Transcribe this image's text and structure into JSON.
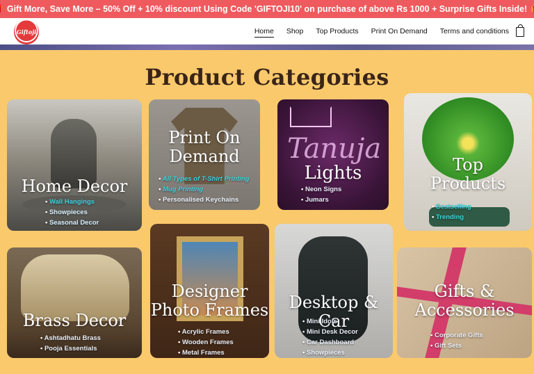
{
  "promo": {
    "text": "Gift More, Save More – 50% Off + 10% discount Using Code 'GIFTOJI10' on purchase of above Rs 1000 + Surprise Gifts Inside!",
    "gift_glyph": "🎁"
  },
  "header": {
    "logo_text": "Giftoji",
    "nav": [
      "Home",
      "Shop",
      "Top Products",
      "Print On Demand",
      "Terms and conditions"
    ]
  },
  "page": {
    "title": "Product Categories"
  },
  "categories": [
    {
      "title": "Home Decor",
      "items": [
        "Wall Hangings",
        "Showpieces",
        "Seasonal Decor"
      ]
    },
    {
      "title_lines": [
        "Print On",
        "Demand"
      ],
      "items": [
        "All Types of T-Shirt Printing",
        "Mug Printing",
        "Personalised Keychains"
      ]
    },
    {
      "title": "Lights",
      "items": [
        "Neon Signs",
        "Jumars"
      ],
      "sign_text": "Tanuja"
    },
    {
      "title_lines": [
        "Top",
        "Products"
      ],
      "items": [
        "Bestselling",
        "Trending"
      ]
    },
    {
      "title": "Brass Decor",
      "items": [
        "Ashtadhatu Brass",
        "Pooja Essentials"
      ]
    },
    {
      "title_lines": [
        "Designer",
        "Photo Frames"
      ],
      "items": [
        "Acrylic Frames",
        "Wooden Frames",
        "Metal Frames"
      ]
    },
    {
      "title": "Desktop & Car",
      "items": [
        "Mini Idols",
        "Mini Desk Decor",
        "Car Dashboard",
        "Showpieces"
      ]
    },
    {
      "title_lines": [
        "Gifts &",
        "Accessories"
      ],
      "items": [
        "Corporate Gifts",
        "Gift Sets"
      ]
    }
  ],
  "colors": {
    "promo_bg": "#ee5a5e",
    "page_bg": "#f9c96c",
    "title": "#3a2418",
    "item_teal": "#39d3de"
  }
}
